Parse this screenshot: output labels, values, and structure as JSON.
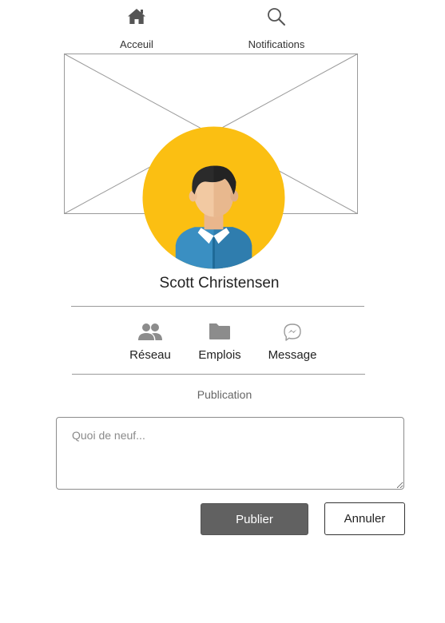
{
  "topnav": {
    "home": {
      "label": "Acceuil",
      "icon": "home-icon"
    },
    "notifications": {
      "label": "Notifications",
      "icon": "search-icon"
    }
  },
  "cover": {
    "icon": "image-placeholder-icon"
  },
  "profile": {
    "name": "Scott Christensen",
    "avatar_bg_color": "#FBBF12"
  },
  "actions": [
    {
      "label": "Réseau",
      "icon": "users-icon"
    },
    {
      "label": "Emplois",
      "icon": "folder-icon"
    },
    {
      "label": "Message",
      "icon": "messenger-icon"
    }
  ],
  "composer": {
    "section_title": "Publication",
    "placeholder": "Quoi de neuf...",
    "value": "",
    "publish_label": "Publier",
    "cancel_label": "Annuler"
  },
  "colors": {
    "primary_button": "#616161",
    "icon_gray": "#8c8c8c"
  }
}
